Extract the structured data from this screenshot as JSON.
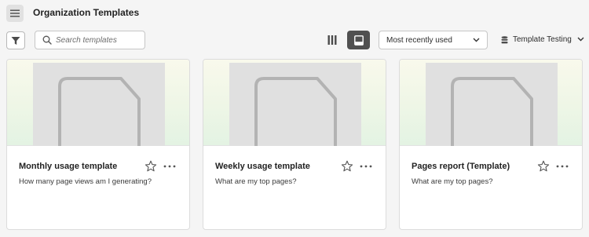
{
  "header": {
    "menu_icon": "hamburger-menu-icon",
    "title": "Organization Templates"
  },
  "toolbar": {
    "filter_icon": "filter-icon",
    "search": {
      "icon": "search-icon",
      "placeholder": "Search templates",
      "value": ""
    },
    "view_toggle": {
      "options": [
        "columns-view-icon",
        "card-view-icon"
      ],
      "selected": "card-view-icon"
    },
    "sort": {
      "selected": "Most recently used",
      "icon": "chevron-down-icon"
    },
    "workspace": {
      "icon": "database-icon",
      "label": "Template Testing",
      "chevron": "chevron-down-icon"
    }
  },
  "cards": [
    {
      "title": "Monthly usage template",
      "description": "How many page views am I generating?",
      "thumbnail_icon": "document-placeholder-icon",
      "favorite": false
    },
    {
      "title": "Weekly usage template",
      "description": "What are my top pages?",
      "thumbnail_icon": "document-placeholder-icon",
      "favorite": false
    },
    {
      "title": "Pages report (Template)",
      "description": "What are my top pages?",
      "thumbnail_icon": "document-placeholder-icon",
      "favorite": false
    }
  ],
  "colors": {
    "background": "#f5f5f5",
    "selected_toggle": "#505050",
    "thumbnail_placeholder": "#e0e0e0",
    "thumbnail_stroke": "#b3b3b3"
  }
}
